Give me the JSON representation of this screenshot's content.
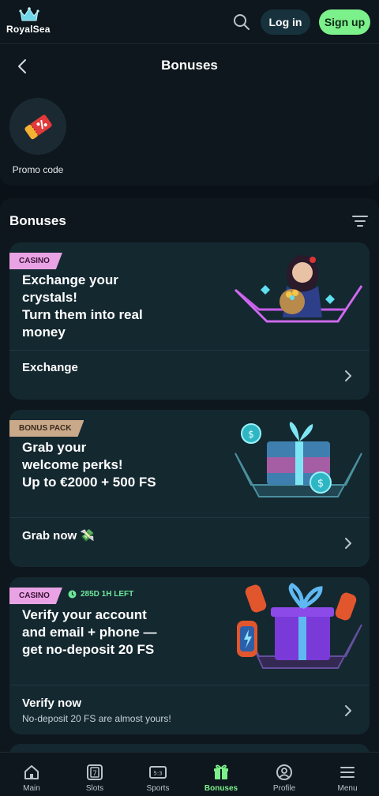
{
  "header": {
    "logo_text": "RoyalSea",
    "login_label": "Log in",
    "signup_label": "Sign up",
    "accent": "#7cf08a"
  },
  "page": {
    "title": "Bonuses",
    "promo_label": "Promo code"
  },
  "section": {
    "title": "Bonuses"
  },
  "cards": [
    {
      "tag": "CASINO",
      "title": "Exchange your\ncrystals!\nTurn them into real\nmoney",
      "action": "Exchange"
    },
    {
      "tag": "BONUS PACK",
      "title": "Grab your\nwelcome perks!\nUp to €2000 + 500 FS",
      "action": "Grab now 💸"
    },
    {
      "tag": "CASINO",
      "timer": "285D 1H LEFT",
      "title": "Verify your account\nand email + phone —\nget no-deposit 20 FS",
      "action": "Verify now",
      "action_sub": "No-deposit 20 FS are almost yours!"
    }
  ],
  "bottom_nav": [
    {
      "label": "Main",
      "icon": "home-icon"
    },
    {
      "label": "Slots",
      "icon": "slots-icon"
    },
    {
      "label": "Sports",
      "icon": "sports-ticket-icon"
    },
    {
      "label": "Bonuses",
      "icon": "gift-icon",
      "active": true
    },
    {
      "label": "Profile",
      "icon": "profile-icon"
    },
    {
      "label": "Menu",
      "icon": "menu-icon"
    }
  ]
}
